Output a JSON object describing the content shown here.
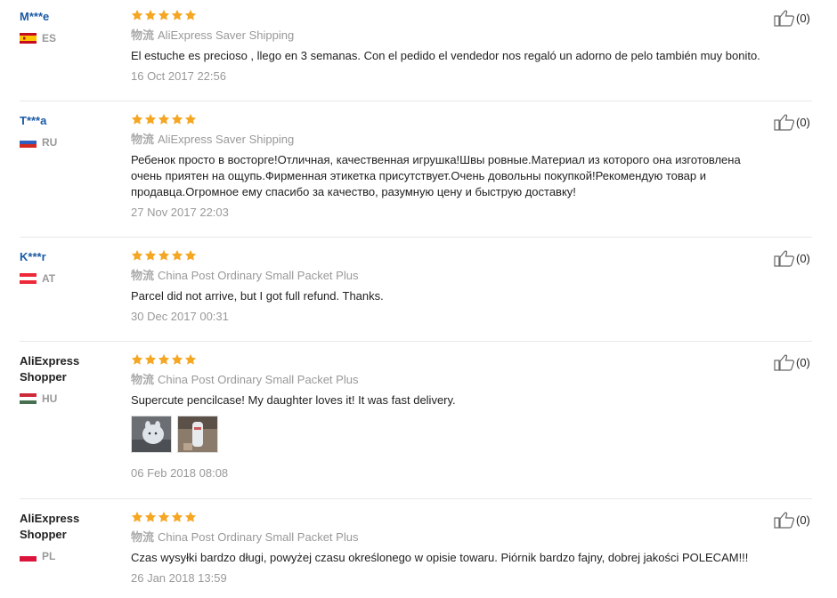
{
  "colors": {
    "star": "#f5a623",
    "name_link": "#1a5aa6",
    "meta_grey": "#999999"
  },
  "icons": {
    "rating_star": "star-icon",
    "helpful": "thumbs-up-icon"
  },
  "reviews": [
    {
      "buyer": "M***e",
      "country": "ES",
      "flag": "flag-spain-icon",
      "rating": 5,
      "shipping_label": "物流",
      "shipping": "AliExpress Saver Shipping",
      "text": "El estuche es precioso , llego en 3 semanas. Con el pedido el vendedor nos regaló un adorno de pelo también muy bonito.",
      "date": "16 Oct 2017 22:56",
      "helpful": "(0)"
    },
    {
      "buyer": "T***a",
      "country": "RU",
      "flag": "flag-russia-icon",
      "rating": 5,
      "shipping_label": "物流",
      "shipping": "AliExpress Saver Shipping",
      "text": "Ребенок просто в восторге!Отличная, качественная игрушка!Швы ровные.Материал из которого она изготовлена очень приятен на ощупь.Фирменная этикетка присутствует.Очень довольны покупкой!Рекомендую товар и продавца.Огромное ему спасибо за качество, разумную цену и быструю доставку!",
      "date": "27 Nov 2017 22:03",
      "helpful": "(0)"
    },
    {
      "buyer": "K***r",
      "country": "AT",
      "flag": "flag-austria-icon",
      "rating": 5,
      "shipping_label": "物流",
      "shipping": "China Post Ordinary Small Packet Plus",
      "text": "Parcel did not arrive, but I got full refund. Thanks.",
      "date": "30 Dec 2017 00:31",
      "helpful": "(0)"
    },
    {
      "buyer": "AliExpress Shopper",
      "country": "HU",
      "flag": "flag-hungary-icon",
      "rating": 5,
      "shipping_label": "物流",
      "shipping": "China Post Ordinary Small Packet Plus",
      "text": "Supercute pencilcase! My daughter loves it! It was fast delivery.",
      "date": "06 Feb 2018 08:08",
      "helpful": "(0)",
      "photos": [
        "review-photo-1",
        "review-photo-2"
      ]
    },
    {
      "buyer": "AliExpress Shopper",
      "country": "PL",
      "flag": "flag-poland-icon",
      "rating": 5,
      "shipping_label": "物流",
      "shipping": "China Post Ordinary Small Packet Plus",
      "text": "Czas wysyłki bardzo długi, powyżej czasu określonego w opisie towaru. Piórnik bardzo fajny, dobrej jakości POLECAM!!!",
      "date": "26 Jan 2018 13:59",
      "helpful": "(0)"
    }
  ]
}
